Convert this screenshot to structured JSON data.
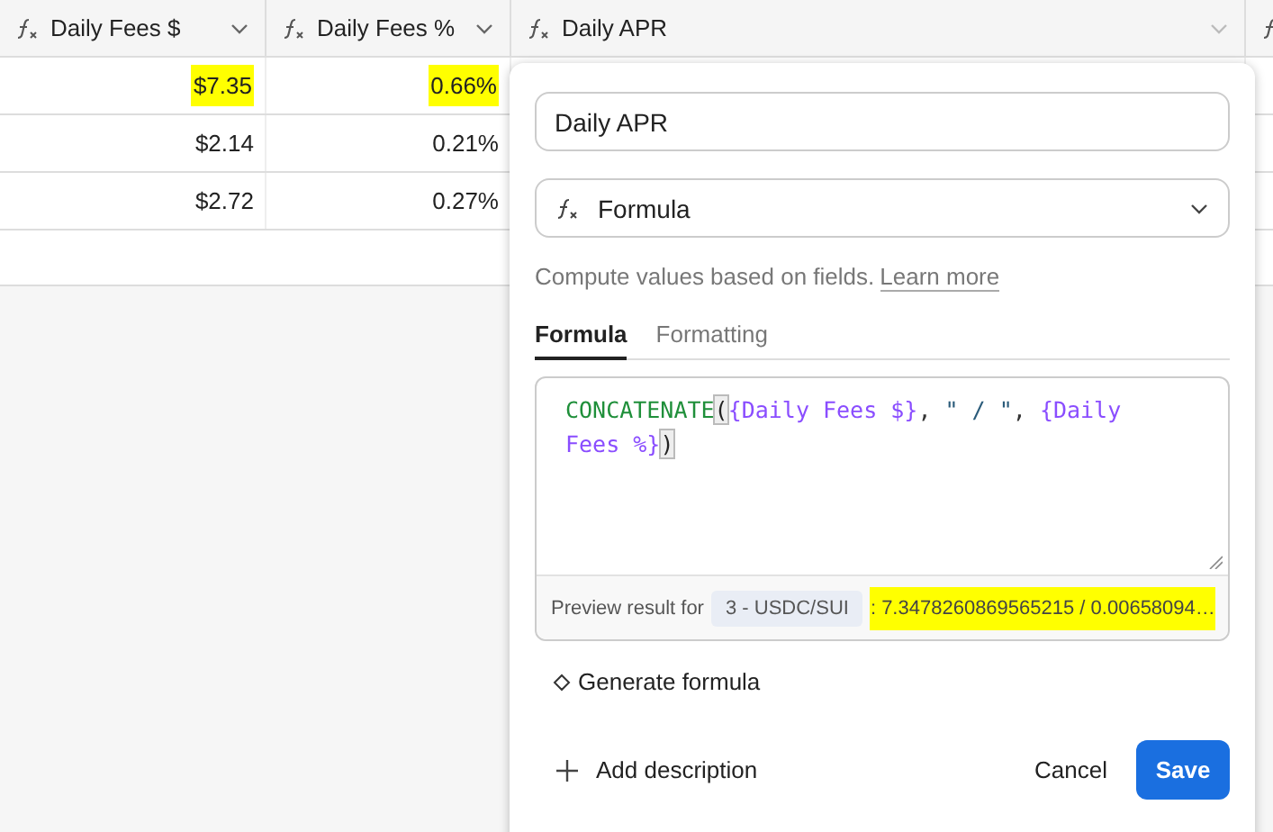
{
  "columns": [
    {
      "label": "Daily Fees $"
    },
    {
      "label": "Daily Fees %"
    },
    {
      "label": "Daily APR"
    }
  ],
  "rows": [
    {
      "cells": [
        {
          "text": "$7.35",
          "highlighted": true
        },
        {
          "text": "0.66%",
          "highlighted": true
        }
      ]
    },
    {
      "cells": [
        {
          "text": "$2.14",
          "highlighted": false
        },
        {
          "text": "0.21%",
          "highlighted": false
        }
      ]
    },
    {
      "cells": [
        {
          "text": "$2.72",
          "highlighted": false
        },
        {
          "text": "0.27%",
          "highlighted": false
        }
      ]
    }
  ],
  "popover": {
    "name_field": {
      "value": "Daily APR"
    },
    "type_select": {
      "value": "Formula"
    },
    "help_text": "Compute values based on fields.",
    "help_link": "Learn more",
    "tabs": [
      {
        "label": "Formula",
        "selected": true
      },
      {
        "label": "Formatting",
        "selected": false
      }
    ],
    "formula_tokens": [
      {
        "kind": "function",
        "text": "CONCATENATE"
      },
      {
        "kind": "bracket",
        "text": "("
      },
      {
        "kind": "field",
        "text": "{Daily Fees $}"
      },
      {
        "kind": "punct",
        "text": ", "
      },
      {
        "kind": "string",
        "text": "\" / \""
      },
      {
        "kind": "punct",
        "text": ", "
      },
      {
        "kind": "field",
        "text": "{Daily Fees %}"
      },
      {
        "kind": "bracket",
        "text": ")"
      }
    ],
    "preview": {
      "label": "Preview result for",
      "record": "3 - USDC/SUI",
      "result": ": 7.3478260869565215 / 0.00658094…",
      "highlighted": true
    },
    "generate_button": "Generate formula",
    "add_description": "Add description",
    "cancel": "Cancel",
    "save": "Save"
  }
}
